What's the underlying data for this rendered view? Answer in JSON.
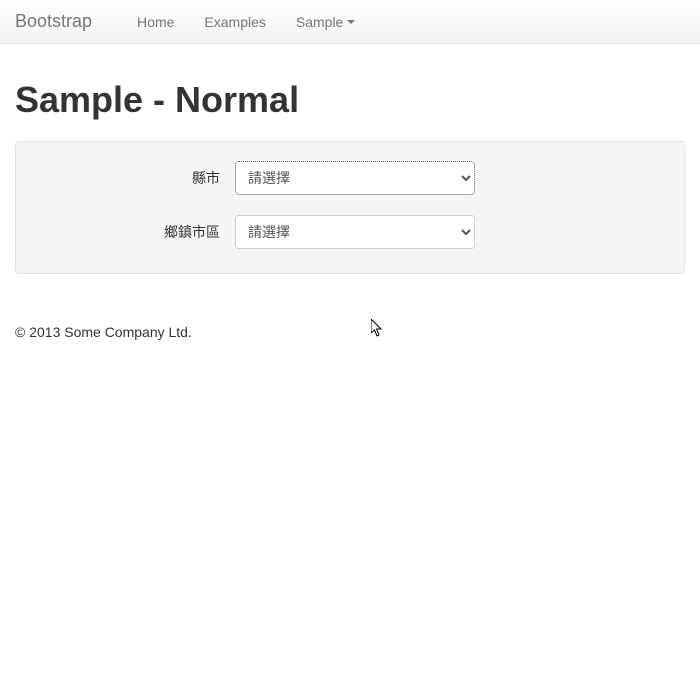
{
  "navbar": {
    "brand": "Bootstrap",
    "items": [
      {
        "label": "Home"
      },
      {
        "label": "Examples"
      },
      {
        "label": "Sample",
        "dropdown": true
      }
    ]
  },
  "page": {
    "title": "Sample - Normal"
  },
  "form": {
    "county": {
      "label": "縣市",
      "selected": "請選擇"
    },
    "district": {
      "label": "鄉鎮市區",
      "selected": "請選擇"
    }
  },
  "footer": {
    "copyright": "© 2013 Some Company Ltd."
  }
}
